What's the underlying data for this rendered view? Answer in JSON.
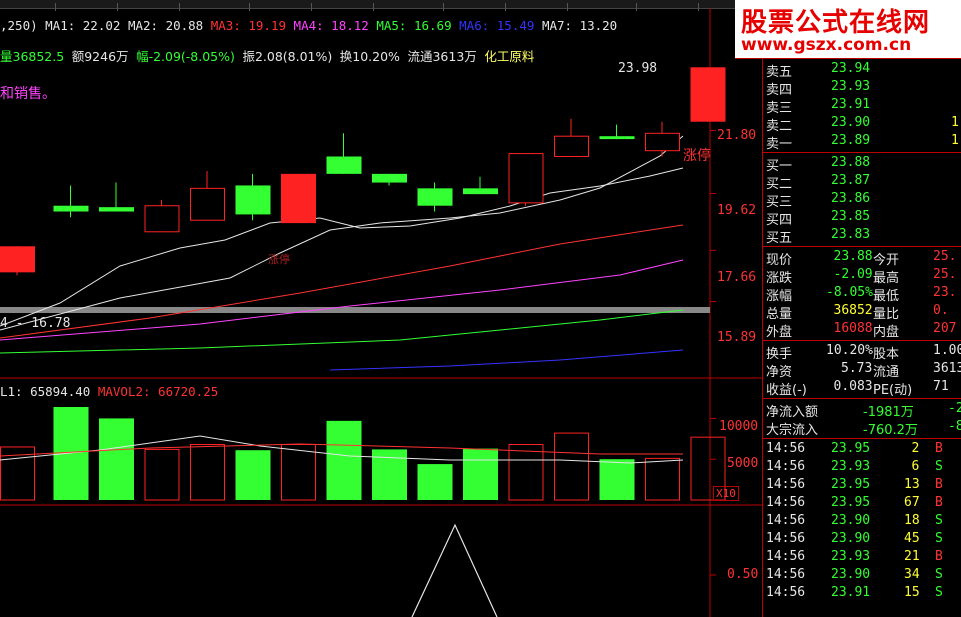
{
  "ma_bar": {
    "prefix": ",250)",
    "items": [
      {
        "label": "MA1:",
        "value": "22.02",
        "color": "#e6e6e6"
      },
      {
        "label": "MA2:",
        "value": "20.88",
        "color": "#e6e6e6"
      },
      {
        "label": "MA3:",
        "value": "19.19",
        "color": "#ff3333"
      },
      {
        "label": "MA4:",
        "value": "18.12",
        "color": "#ff44ff"
      },
      {
        "label": "MA5:",
        "value": "16.69",
        "color": "#33ff33"
      },
      {
        "label": "MA6:",
        "value": "15.49",
        "color": "#3333ff"
      },
      {
        "label": "MA7:",
        "value": "13.20",
        "color": "#e6e6e6"
      }
    ]
  },
  "info_bar": {
    "volume": "量36852.5",
    "amount": "额9246万",
    "change": "幅-2.09(-8.05%)",
    "amplitude": "振2.08(8.01%)",
    "turnover": "换10.20%",
    "float": "流通3613万",
    "sector": "化工原料"
  },
  "note_text": "和销售。",
  "price_axis": [
    "21.80",
    "19.62",
    "17.66",
    "15.89"
  ],
  "price_tag_high": "23.98",
  "limit_up_label": "涨停",
  "limit_up_label_2": "涨停",
  "low_price_label": "4 - 16.78",
  "vol_bar": {
    "vol_label": "L1: 65894.40",
    "mavol_label": "MAVOL2: 66720.25"
  },
  "vol_axis": [
    "10000",
    "5000"
  ],
  "vol_unit": "X10",
  "ind_axis": "0.50",
  "candles": [
    {
      "o": 17.8,
      "c": 16.9,
      "h": 17.8,
      "l": 16.8,
      "type": "red-fill"
    },
    {
      "o": 19.0,
      "c": 19.2,
      "h": 19.9,
      "l": 18.8,
      "type": "green"
    },
    {
      "o": 19.0,
      "c": 19.15,
      "h": 20.0,
      "l": 19.0,
      "type": "green"
    },
    {
      "o": 18.3,
      "c": 19.2,
      "h": 19.4,
      "l": 18.3,
      "type": "red-hollow"
    },
    {
      "o": 18.7,
      "c": 19.8,
      "h": 20.4,
      "l": 18.7,
      "type": "red-hollow"
    },
    {
      "o": 19.9,
      "c": 18.9,
      "h": 20.3,
      "l": 18.7,
      "type": "green"
    },
    {
      "o": 18.6,
      "c": 20.3,
      "h": 20.3,
      "l": 18.6,
      "type": "red-fill"
    },
    {
      "o": 20.9,
      "c": 20.3,
      "h": 21.7,
      "l": 20.3,
      "type": "green"
    },
    {
      "o": 20.3,
      "c": 20.0,
      "h": 20.3,
      "l": 19.9,
      "type": "green"
    },
    {
      "o": 19.8,
      "c": 19.2,
      "h": 20.0,
      "l": 19.0,
      "type": "green"
    },
    {
      "o": 19.8,
      "c": 19.6,
      "h": 20.2,
      "l": 19.6,
      "type": "green"
    },
    {
      "o": 19.3,
      "c": 21.0,
      "h": 21.0,
      "l": 19.2,
      "type": "red-hollow"
    },
    {
      "o": 20.9,
      "c": 21.6,
      "h": 22.2,
      "l": 20.9,
      "type": "red-hollow"
    },
    {
      "o": 21.6,
      "c": 21.5,
      "h": 22.0,
      "l": 21.5,
      "type": "green"
    },
    {
      "o": 21.1,
      "c": 21.7,
      "h": 22.1,
      "l": 20.9,
      "type": "red-hollow"
    },
    {
      "o": 22.1,
      "c": 23.98,
      "h": 23.98,
      "l": 22.1,
      "type": "red-fill"
    }
  ],
  "volumes": [
    {
      "v": 6500,
      "type": "red-hollow"
    },
    {
      "v": 11400,
      "type": "green"
    },
    {
      "v": 10000,
      "type": "green"
    },
    {
      "v": 6200,
      "type": "red-hollow"
    },
    {
      "v": 6800,
      "type": "red-hollow"
    },
    {
      "v": 6100,
      "type": "green"
    },
    {
      "v": 6800,
      "type": "red-hollow"
    },
    {
      "v": 9700,
      "type": "green"
    },
    {
      "v": 6200,
      "type": "green"
    },
    {
      "v": 4400,
      "type": "green"
    },
    {
      "v": 6300,
      "type": "green"
    },
    {
      "v": 6800,
      "type": "red-hollow"
    },
    {
      "v": 8200,
      "type": "red-hollow"
    },
    {
      "v": 5000,
      "type": "green"
    },
    {
      "v": 5100,
      "type": "red-hollow"
    },
    {
      "v": 7700,
      "type": "red-hollow"
    }
  ],
  "right_panel": {
    "asks": [
      {
        "label": "卖五",
        "price": "23.94",
        "vol": ""
      },
      {
        "label": "卖四",
        "price": "23.93",
        "vol": ""
      },
      {
        "label": "卖三",
        "price": "23.91",
        "vol": ""
      },
      {
        "label": "卖二",
        "price": "23.90",
        "vol": "1"
      },
      {
        "label": "卖一",
        "price": "23.89",
        "vol": "1"
      }
    ],
    "bids": [
      {
        "label": "买一",
        "price": "23.88",
        "vol": ""
      },
      {
        "label": "买二",
        "price": "23.87",
        "vol": ""
      },
      {
        "label": "买三",
        "price": "23.86",
        "vol": ""
      },
      {
        "label": "买四",
        "price": "23.85",
        "vol": ""
      },
      {
        "label": "买五",
        "price": "23.83",
        "vol": ""
      }
    ],
    "stats": [
      {
        "l1": "现价",
        "v1": "23.88",
        "c1": "#33ff33",
        "l2": "今开",
        "v2": "25."
      },
      {
        "l1": "涨跌",
        "v1": "-2.09",
        "c1": "#33ff33",
        "l2": "最高",
        "v2": "25."
      },
      {
        "l1": "涨幅",
        "v1": "-8.05%",
        "c1": "#33ff33",
        "l2": "最低",
        "v2": "23."
      },
      {
        "l1": "总量",
        "v1": "36852",
        "c1": "#ffff33",
        "l2": "量比",
        "v2": "0."
      },
      {
        "l1": "外盘",
        "v1": "16088",
        "c1": "#ff3333",
        "l2": "内盘",
        "v2": "207"
      }
    ],
    "stats2": [
      {
        "l1": "换手",
        "v1": "10.20%",
        "l2": "股本",
        "v2": "1.00"
      },
      {
        "l1": "净资",
        "v1": "5.73",
        "l2": "流通",
        "v2": "3613"
      },
      {
        "l1": "收益(-)",
        "v1": "0.083",
        "l2": "PE(动)",
        "v2": "71"
      }
    ],
    "flow": [
      {
        "label": "净流入额",
        "value": "-1981万",
        "extra": "-2"
      },
      {
        "label": "大宗流入",
        "value": "-760.2万",
        "extra": "-8"
      }
    ],
    "trades": [
      {
        "t": "14:56",
        "p": "23.95",
        "v": "2",
        "s": "B"
      },
      {
        "t": "14:56",
        "p": "23.93",
        "v": "6",
        "s": "S"
      },
      {
        "t": "14:56",
        "p": "23.95",
        "v": "13",
        "s": "B"
      },
      {
        "t": "14:56",
        "p": "23.95",
        "v": "67",
        "s": "B"
      },
      {
        "t": "14:56",
        "p": "23.90",
        "v": "18",
        "s": "S"
      },
      {
        "t": "14:56",
        "p": "23.90",
        "v": "45",
        "s": "S"
      },
      {
        "t": "14:56",
        "p": "23.93",
        "v": "21",
        "s": "B"
      },
      {
        "t": "14:56",
        "p": "23.90",
        "v": "34",
        "s": "S"
      },
      {
        "t": "14:56",
        "p": "23.91",
        "v": "15",
        "s": "S"
      }
    ]
  },
  "logo": {
    "title": "股票公式在线网",
    "url": "www.gszx.com.cn"
  }
}
